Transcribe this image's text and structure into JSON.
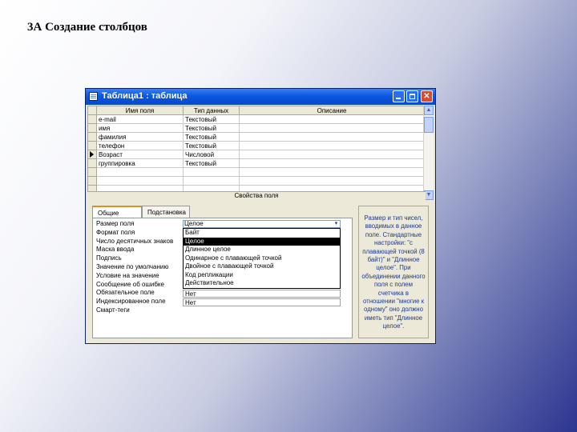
{
  "slide_title": "3А Создание столбцов",
  "window": {
    "title": "Таблица1 : таблица",
    "buttons": {
      "minimize": "_",
      "maximize": "□",
      "close": "✕"
    }
  },
  "grid": {
    "headers": [
      "Имя поля",
      "Тип данных",
      "Описание"
    ],
    "rows": [
      [
        "e-mail",
        "Текстовый",
        ""
      ],
      [
        "имя",
        "Текстовый",
        ""
      ],
      [
        "фамилия",
        "Текстовый",
        ""
      ],
      [
        "телефон",
        "Текстовый",
        ""
      ],
      [
        "Возраст",
        "Числовой",
        ""
      ],
      [
        "группировка",
        "Текстовый",
        ""
      ]
    ],
    "current_row_index": 4
  },
  "field_props_caption": "Свойства поля",
  "tabs": [
    "Общие",
    "Подстановка"
  ],
  "properties": [
    "Размер поля",
    "Формат поля",
    "Число десятичных знаков",
    "Маска ввода",
    "Подпись",
    "Значение по умолчанию",
    "Условие на значение",
    "Сообщение об ошибке",
    "Обязательное поле",
    "Индексированное поле",
    "Смарт-теги"
  ],
  "field_size_value": "Целое",
  "dropdown_options": [
    "Байт",
    "Целое",
    "Длинное целое",
    "Одинарное с плавающей точкой",
    "Двойное с плавающей точкой",
    "Код репликации",
    "Действительное"
  ],
  "dropdown_selected_index": 1,
  "required_value": "Нет",
  "indexed_value": "Нет",
  "hint": "Размер и тип чисел, вводимых в данное поле. Стандартные настройки: \"с плавающей точкой (8 байт)\" и \"Длинное целое\". При объединении данного поля с полем счетчика в отношении \"многие к одному\" оно должно иметь тип \"Длинное целое\"."
}
